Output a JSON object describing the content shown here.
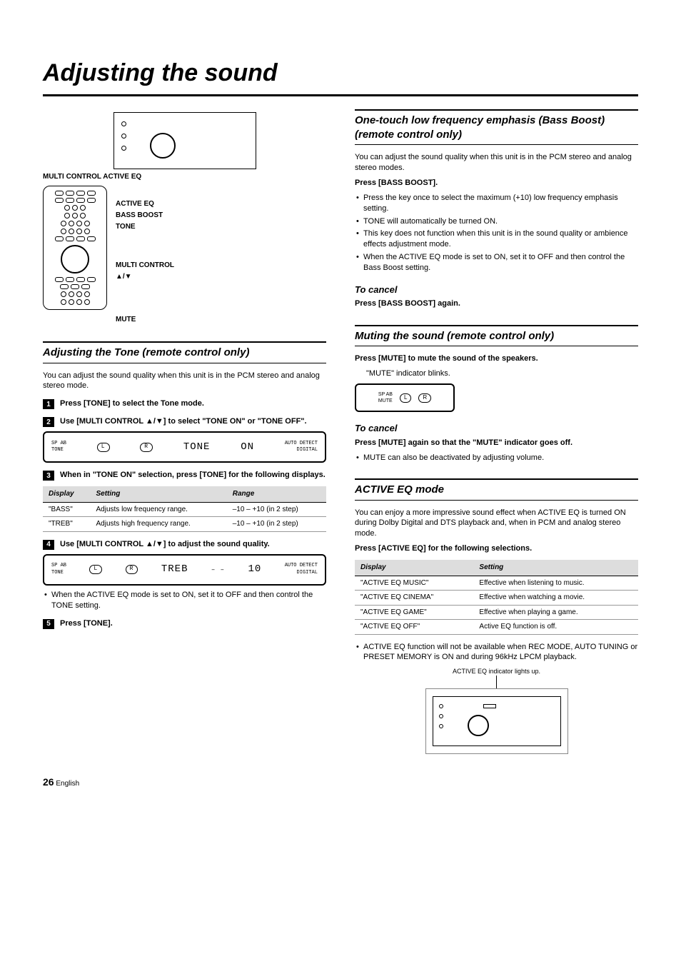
{
  "page_title": "Adjusting the sound",
  "left": {
    "diagram_labels_top": "MULTI CONTROL   ACTIVE EQ",
    "remote_labels": [
      "ACTIVE EQ",
      "BASS BOOST",
      "TONE",
      "MULTI CONTROL",
      "▲/▼",
      "MUTE"
    ],
    "tone": {
      "heading": "Adjusting the Tone (remote control only)",
      "intro": "You can adjust the sound quality when this unit is in the PCM stereo and analog stereo mode.",
      "steps": [
        {
          "n": "1",
          "text": "Press [TONE] to select the Tone mode."
        },
        {
          "n": "2",
          "text": "Use [MULTI CONTROL ▲/▼] to select \"TONE ON\" or \"TONE OFF\"."
        },
        {
          "n": "3",
          "text": "When in \"TONE ON\" selection, press [TONE] for the following displays."
        },
        {
          "n": "4",
          "text": "Use [MULTI CONTROL ▲/▼] to adjust the sound quality."
        },
        {
          "n": "5",
          "text": "Press [TONE]."
        }
      ],
      "lcd1": {
        "left_small": "SP AB\nTONE",
        "lr": [
          "L",
          "R"
        ],
        "main": "TONE",
        "right": "ON",
        "tag": "AUTO DETECT\nDIGITAL"
      },
      "table": {
        "headers": [
          "Display",
          "Setting",
          "Range"
        ],
        "rows": [
          [
            "\"BASS\"",
            "Adjusts low frequency range.",
            "–10 – +10 (in 2 step)"
          ],
          [
            "\"TREB\"",
            "Adjusts high frequency range.",
            "–10 – +10 (in 2 step)"
          ]
        ]
      },
      "lcd2": {
        "left_small": "SP AB\nTONE",
        "lr": [
          "L",
          "R"
        ],
        "main": "TREB",
        "right": "10",
        "tag": "AUTO DETECT\nDIGITAL"
      },
      "note": "When the ACTIVE EQ mode is set to ON, set it to OFF and then control the TONE setting."
    }
  },
  "right": {
    "bass": {
      "heading": "One-touch low frequency emphasis (Bass Boost) (remote control only)",
      "intro": "You can adjust the sound quality when this unit is in the PCM stereo and analog stereo modes.",
      "press": "Press [BASS BOOST].",
      "bullets": [
        "Press the key once to select the maximum (+10) low frequency emphasis setting.",
        "TONE will automatically be turned ON.",
        "This key does not function when this unit is in the sound quality or ambience effects adjustment mode.",
        "When the ACTIVE EQ mode is set to ON, set it to OFF and then control the Bass Boost setting."
      ],
      "cancel_h": "To cancel",
      "cancel_b": "Press [BASS BOOST] again."
    },
    "mute": {
      "heading": "Muting the sound (remote control only)",
      "press": "Press [MUTE] to mute the sound of the speakers.",
      "sub": "\"MUTE\" indicator blinks.",
      "lcd_small": {
        "left": "SP AB\nMUTE",
        "lr": [
          "L",
          "R"
        ]
      },
      "cancel_h": "To cancel",
      "cancel_b": "Press [MUTE] again so that the \"MUTE\" indicator goes off.",
      "bullet": "MUTE can also be deactivated by adjusting volume."
    },
    "aeq": {
      "heading": "ACTIVE EQ mode",
      "intro": "You can enjoy a more impressive sound effect when ACTIVE EQ is turned ON during Dolby Digital and DTS playback and, when in PCM and analog stereo mode.",
      "press": "Press [ACTIVE EQ] for the following selections.",
      "table": {
        "headers": [
          "Display",
          "Setting"
        ],
        "rows": [
          [
            "\"ACTIVE EQ MUSIC\"",
            "Effective when listening to music."
          ],
          [
            "\"ACTIVE EQ CINEMA\"",
            "Effective when watching a movie."
          ],
          [
            "\"ACTIVE EQ GAME\"",
            "Effective when playing a game."
          ],
          [
            "\"ACTIVE EQ OFF\"",
            "Active EQ function is off."
          ]
        ]
      },
      "bullet": "ACTIVE EQ function will not be available when REC MODE, AUTO TUNING or PRESET MEMORY is ON and during 96kHz LPCM playback.",
      "caption": "ACTIVE EQ indicator lights up."
    }
  },
  "footer": {
    "num": "26",
    "lang": "English"
  }
}
